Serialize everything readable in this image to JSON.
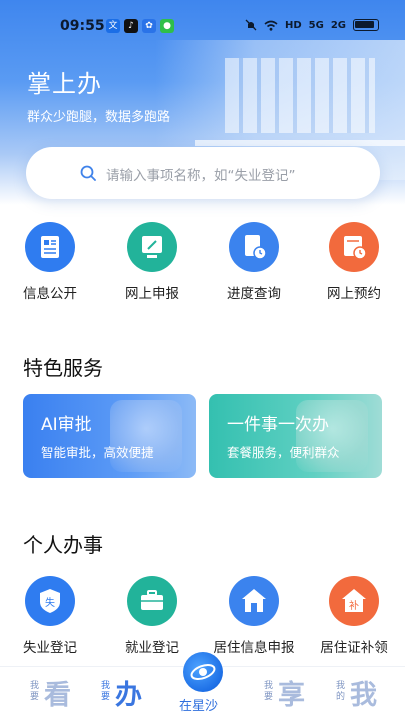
{
  "status_bar": {
    "time": "09:55",
    "app_icons": [
      "文",
      "♪",
      "✿",
      "●"
    ],
    "indicators": [
      "HD",
      "5G",
      "2G"
    ]
  },
  "header": {
    "title": "掌上办",
    "subtitle": "群众少跑腿，数据多跑路"
  },
  "search": {
    "placeholder": "请输入事项名称，如“失业登记”"
  },
  "quick_actions": [
    {
      "label": "信息公开",
      "icon": "document-list-icon",
      "color": "#2f7cf0"
    },
    {
      "label": "网上申报",
      "icon": "edit-screen-icon",
      "color": "#22b39a"
    },
    {
      "label": "进度查询",
      "icon": "progress-clock-icon",
      "color": "#3b83ee"
    },
    {
      "label": "网上预约",
      "icon": "calendar-clock-icon",
      "color": "#f26a3d"
    }
  ],
  "featured": {
    "title": "特色服务",
    "cards": [
      {
        "title": "AI审批",
        "subtitle": "智能审批，高效便捷",
        "color": "#3d84f2"
      },
      {
        "title": "一件事一次办",
        "subtitle": "套餐服务，便利群众",
        "color": "#35c3b3"
      }
    ]
  },
  "personal": {
    "title": "个人办事",
    "items": [
      {
        "label": "失业登记",
        "icon": "unemployment-shield-icon",
        "glyph": "失",
        "color": "#2f7cf0"
      },
      {
        "label": "就业登记",
        "icon": "briefcase-icon",
        "glyph": "",
        "color": "#22b39a"
      },
      {
        "label": "居住信息申报",
        "icon": "house-icon",
        "glyph": "",
        "color": "#3b83ee"
      },
      {
        "label": "居住证补领",
        "icon": "house-reissue-icon",
        "glyph": "补",
        "color": "#f26a3d"
      }
    ]
  },
  "tabbar": {
    "tabs": [
      {
        "small": "我要",
        "big": "看",
        "active": false
      },
      {
        "small": "我要",
        "big": "办",
        "active": true
      },
      {
        "small": "我要",
        "big": "享",
        "active": false
      },
      {
        "small": "我的",
        "big": "我",
        "active": false
      }
    ],
    "center_label": "在星沙"
  }
}
